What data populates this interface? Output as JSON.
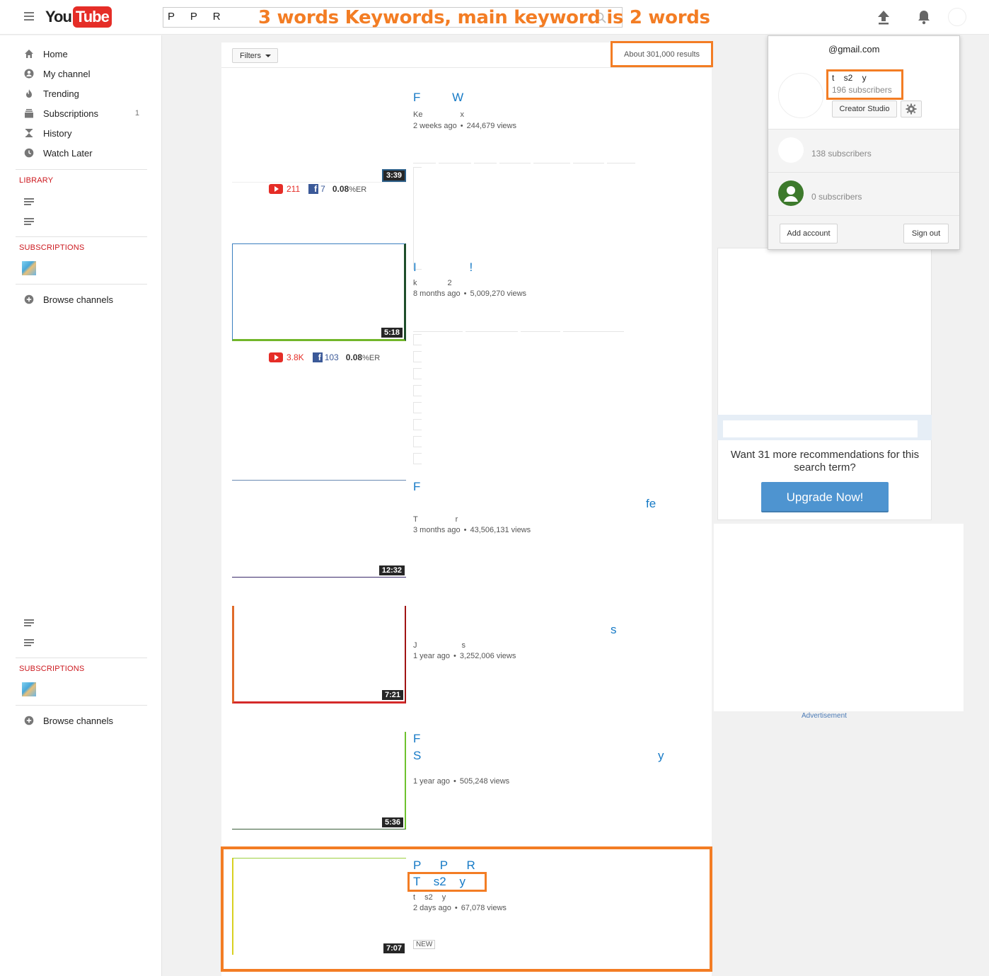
{
  "masthead": {
    "logo_you": "You",
    "logo_tube": "Tube",
    "search_value": "P P R",
    "overlay_note": "3 words Keywords, main keyword is 2 words"
  },
  "guide": {
    "items": [
      {
        "label": "Home",
        "icon": "home-icon"
      },
      {
        "label": "My channel",
        "icon": "person-icon"
      },
      {
        "label": "Trending",
        "icon": "flame-icon"
      },
      {
        "label": "Subscriptions",
        "icon": "subscriptions-icon",
        "count": "1"
      },
      {
        "label": "History",
        "icon": "hourglass-icon"
      },
      {
        "label": "Watch Later",
        "icon": "clock-icon"
      }
    ],
    "library_heading": "LIBRARY",
    "subscriptions_heading": "SUBSCRIPTIONS",
    "browse_channels": "Browse channels",
    "subscriptions_heading_2": "SUBSCRIPTIONS",
    "browse_channels_2": "Browse channels"
  },
  "results": {
    "filters_label": "Filters",
    "count": "About 301,000 results",
    "videos": [
      {
        "title": "F W",
        "channel": "Ke x",
        "age": "2 weeks ago",
        "views": "244,679 views",
        "duration": "3:39",
        "yt": "211",
        "fb": "7",
        "er": "0.08",
        "er_unit": "%ER"
      },
      {
        "title": "I !",
        "channel": "k 2",
        "age": "8 months ago",
        "views": "5,009,270 views",
        "duration": "5:18",
        "yt": "3.8K",
        "fb": "103",
        "er": "0.08",
        "er_unit": "%ER"
      },
      {
        "title": "F",
        "title2": "fe",
        "channel": "T r",
        "age": "3 months ago",
        "views": "43,506,131 views",
        "duration": "12:32"
      },
      {
        "title": "s",
        "channel": "J s",
        "age": "1 year ago",
        "views": "3,252,006 views",
        "duration": "7:21"
      },
      {
        "title": "F",
        "title2": "S y",
        "age": "1 year ago",
        "views": "505,248 views",
        "duration": "5:36"
      },
      {
        "title": "P P R",
        "title2": "T s2 y",
        "channel": "t s2 y",
        "age": "2 days ago",
        "views": "67,078 views",
        "duration": "7:07",
        "badge": "NEW"
      }
    ]
  },
  "reco": {
    "text": "Want 31 more recommendations for this search term?",
    "button": "Upgrade Now!",
    "ad_label": "Advertisement"
  },
  "account": {
    "email": "@gmail.com",
    "name": "t s2 y",
    "subs": "196 subscribers",
    "creator_studio": "Creator Studio",
    "other_subs_1": "138 subscribers",
    "other_subs_2": "0 subscribers",
    "add_account": "Add account",
    "sign_out": "Sign out"
  },
  "colors": {
    "accent": "#f37d24",
    "yt_red": "#e52d27",
    "link_blue": "#167ac6",
    "fb_blue": "#3b5998",
    "upgrade_blue": "#4e94d0"
  }
}
